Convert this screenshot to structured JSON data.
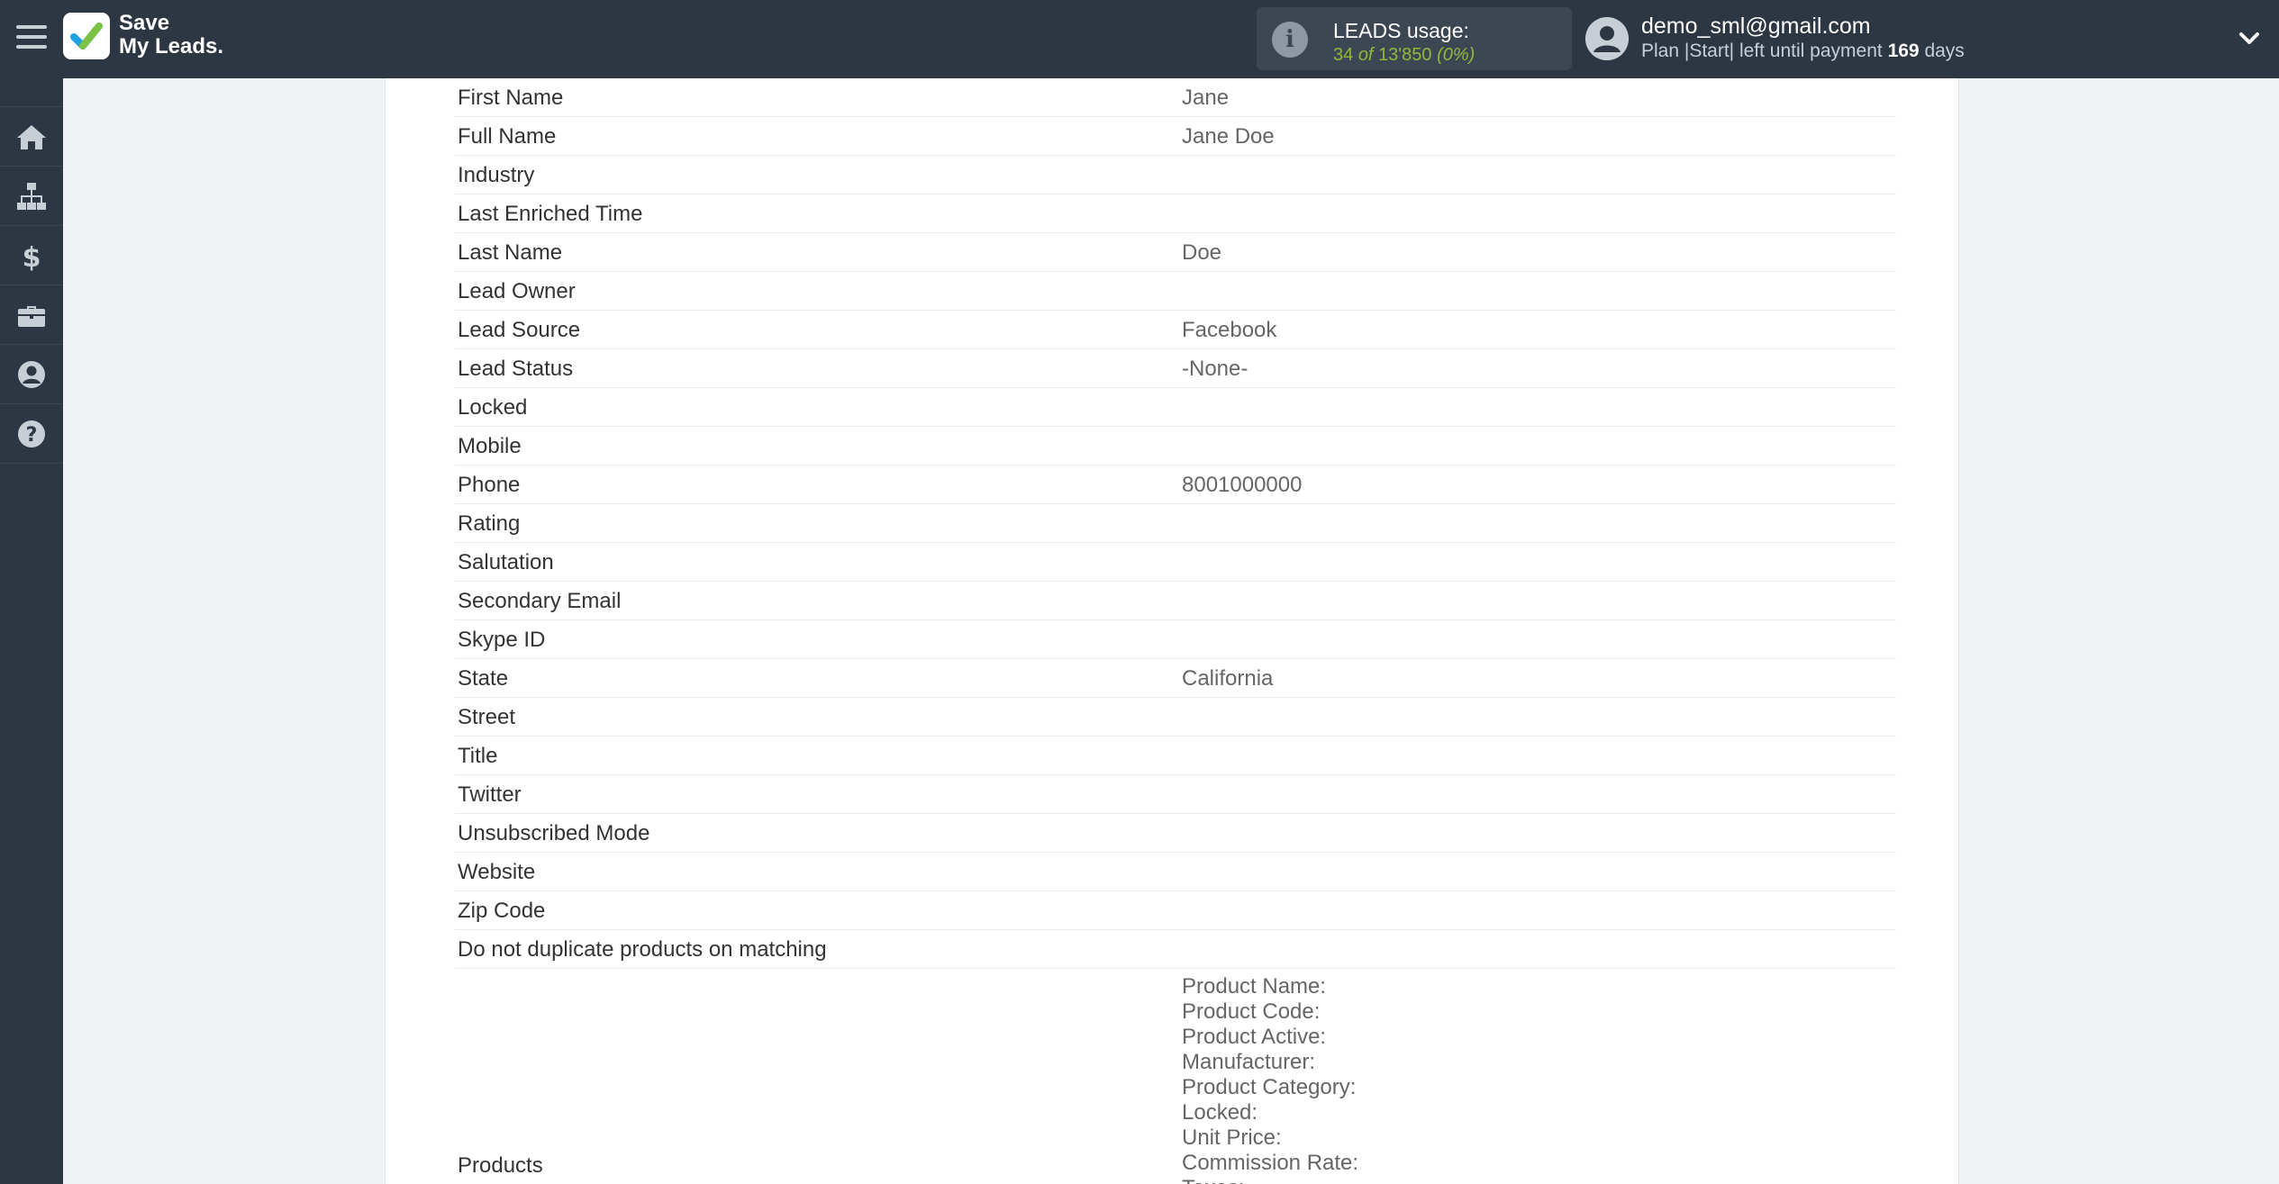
{
  "brand": {
    "line1": "Save",
    "line2": "My Leads."
  },
  "usage": {
    "label": "LEADS usage:",
    "used": "34",
    "of": "of",
    "total": "13'850",
    "percent": "(0%)"
  },
  "account": {
    "email": "demo_sml@gmail.com",
    "plan_prefix": "Plan |Start| left until payment",
    "days_count": "169",
    "days_suffix": "days"
  },
  "sidebar": {
    "icons": [
      "home-icon",
      "sitemap-icon",
      "dollar-icon",
      "briefcase-icon",
      "user-circle-icon",
      "question-circle-icon"
    ]
  },
  "fields": [
    {
      "label": "First Name",
      "value": "Jane"
    },
    {
      "label": "Full Name",
      "value": "Jane Doe"
    },
    {
      "label": "Industry",
      "value": ""
    },
    {
      "label": "Last Enriched Time",
      "value": ""
    },
    {
      "label": "Last Name",
      "value": "Doe"
    },
    {
      "label": "Lead Owner",
      "value": ""
    },
    {
      "label": "Lead Source",
      "value": "Facebook"
    },
    {
      "label": "Lead Status",
      "value": "-None-"
    },
    {
      "label": "Locked",
      "value": ""
    },
    {
      "label": "Mobile",
      "value": ""
    },
    {
      "label": "Phone",
      "value": "8001000000"
    },
    {
      "label": "Rating",
      "value": ""
    },
    {
      "label": "Salutation",
      "value": ""
    },
    {
      "label": "Secondary Email",
      "value": ""
    },
    {
      "label": "Skype ID",
      "value": ""
    },
    {
      "label": "State",
      "value": "California"
    },
    {
      "label": "Street",
      "value": ""
    },
    {
      "label": "Title",
      "value": ""
    },
    {
      "label": "Twitter",
      "value": ""
    },
    {
      "label": "Unsubscribed Mode",
      "value": ""
    },
    {
      "label": "Website",
      "value": ""
    },
    {
      "label": "Zip Code",
      "value": ""
    },
    {
      "label": "Do not duplicate products on matching",
      "value": ""
    }
  ],
  "products": {
    "label": "Products",
    "items": [
      "Product Name:",
      "Product Code:",
      "Product Active:",
      "Manufacturer:",
      "Product Category:",
      "Locked:",
      "Unit Price:",
      "Commission Rate:",
      "Taxes:"
    ]
  }
}
